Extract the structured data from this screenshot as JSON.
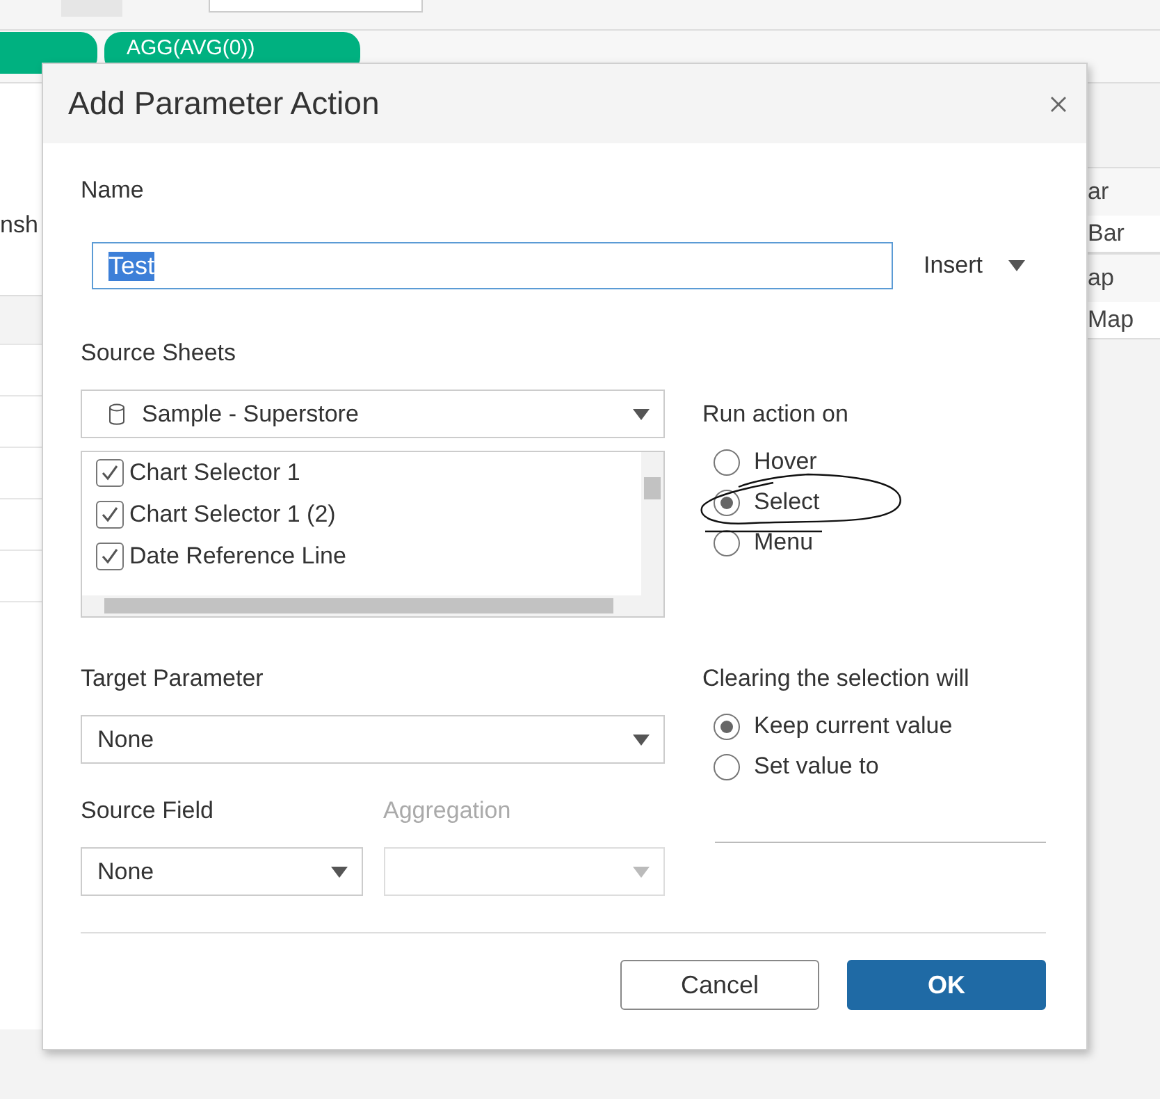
{
  "background": {
    "pill": {
      "label": "AGG(AVG(0))"
    },
    "left_fragment": "nsh",
    "right_items": [
      {
        "label": "ar",
        "kind": "header"
      },
      {
        "label": "Bar",
        "kind": "item"
      },
      {
        "label": "ap",
        "kind": "header"
      },
      {
        "label": "Map",
        "kind": "item"
      }
    ]
  },
  "dialog": {
    "title": "Add Parameter Action",
    "name": {
      "label": "Name",
      "value": "Test",
      "text_selected": true,
      "insert": "Insert"
    },
    "source_sheets": {
      "label": "Source Sheets",
      "datasource": "Sample - Superstore",
      "sheets": [
        {
          "label": "Chart Selector 1",
          "checked": true
        },
        {
          "label": "Chart Selector 1 (2)",
          "checked": true
        },
        {
          "label": "Date Reference Line",
          "checked": true
        }
      ]
    },
    "run_action": {
      "label": "Run action on",
      "options": [
        {
          "label": "Hover",
          "selected": false
        },
        {
          "label": "Select",
          "selected": true
        },
        {
          "label": "Menu",
          "selected": false
        }
      ]
    },
    "target_parameter": {
      "label": "Target Parameter",
      "value": "None"
    },
    "clearing": {
      "label": "Clearing the selection will",
      "options": [
        {
          "label": "Keep current value",
          "selected": true
        },
        {
          "label": "Set value to",
          "selected": false
        }
      ]
    },
    "source_field": {
      "label": "Source Field",
      "value": "None"
    },
    "aggregation": {
      "label": "Aggregation",
      "disabled": true
    },
    "buttons": [
      {
        "label": "Cancel",
        "kind": "secondary"
      },
      {
        "label": "OK",
        "kind": "primary"
      }
    ]
  }
}
